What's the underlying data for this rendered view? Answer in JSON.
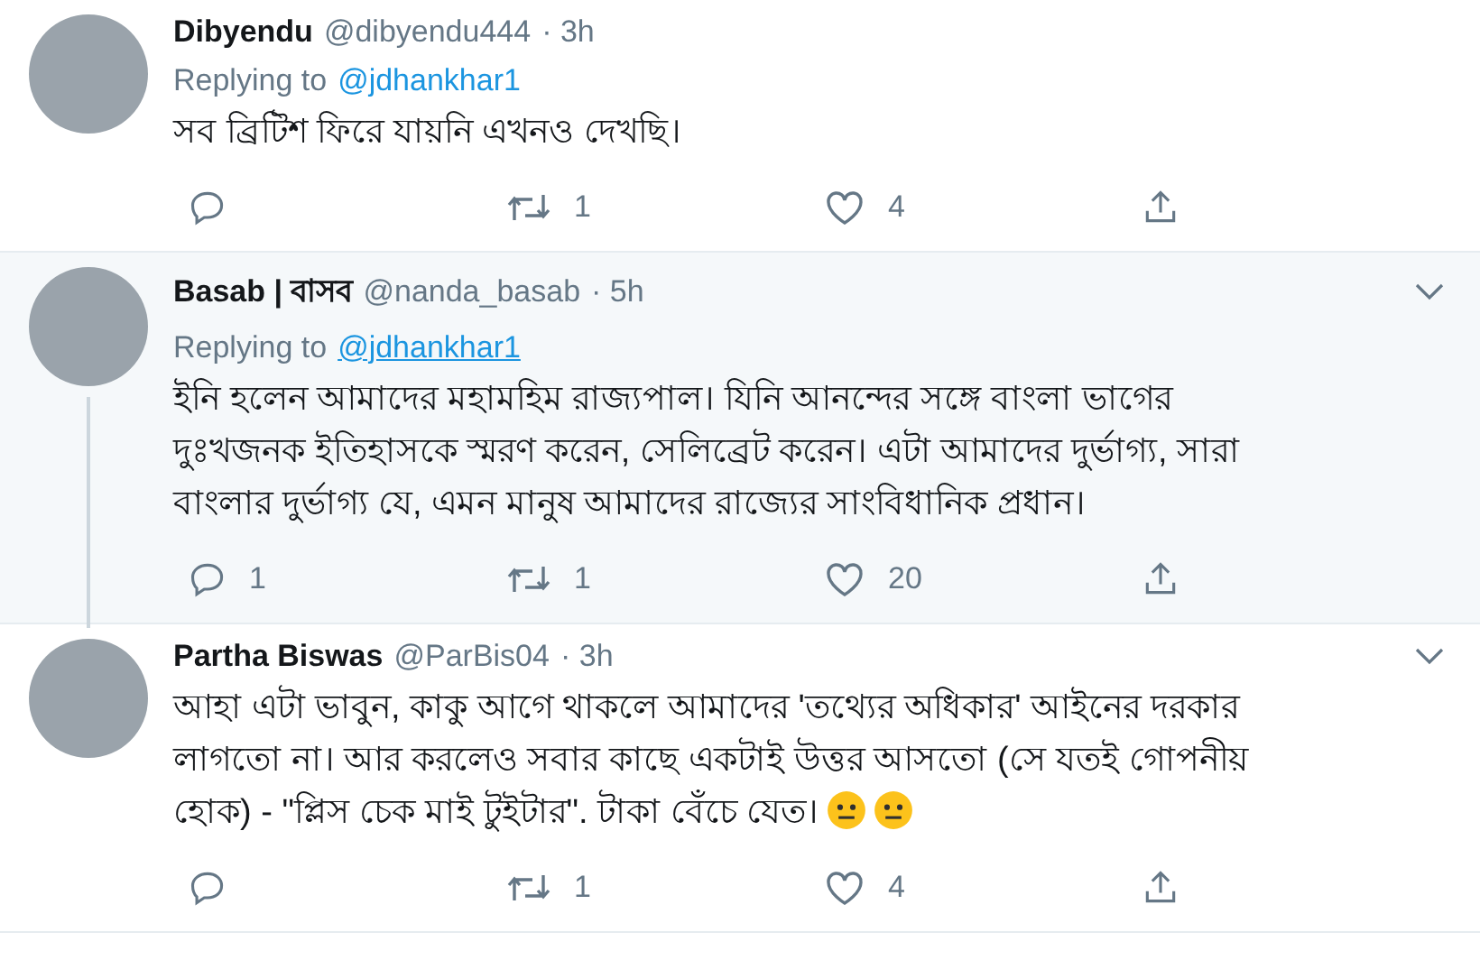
{
  "tweets": [
    {
      "name": "Dibyendu",
      "handle": "@dibyendu444",
      "time": "· 3h",
      "replying_label": "Replying to",
      "replying_to": "@jdhankhar1",
      "body": "সব ব্রিটিশ ফিরে যায়নি এখনও দেখছি।",
      "retweets": "1",
      "likes": "4"
    },
    {
      "name": "Basab | বাসব",
      "handle": "@nanda_basab",
      "time": "· 5h",
      "replying_label": "Replying to",
      "replying_to": "@jdhankhar1",
      "link_underlined": true,
      "highlighted": true,
      "menu": true,
      "thread_line": true,
      "body": "ইনি হলেন আমাদের মহামহিম রাজ্যপাল। যিনি আনন্দের সঙ্গে বাংলা ভাগের দুঃখজনক ইতিহাসকে স্মরণ করেন, সেলিব্রেট করেন। এটা আমাদের দুর্ভাগ্য, সারা বাংলার দুর্ভাগ্য যে, এমন মানুষ আমাদের রাজ্যের সাংবিধানিক প্রধান।",
      "replies": "1",
      "retweets": "1",
      "likes": "20"
    },
    {
      "name": "Partha Biswas",
      "handle": "@ParBis04",
      "time": "· 3h",
      "menu": true,
      "body": "আহা এটা ভাবুন, কাকু আগে থাকলে আমাদের 'তথ্যের অধিকার' আইনের দরকার লাগতো না। আর করলেও সবার কাছে একটাই উত্তর আসতো (সে যতই গোপনীয় হোক) - \"প্লিস চেক মাই টুইটার\". টাকা বেঁচে যেত।",
      "reactions": [
        {
          "kind": "neutral-face"
        },
        {
          "kind": "neutral-face"
        }
      ],
      "retweets": "1",
      "likes": "4"
    }
  ]
}
